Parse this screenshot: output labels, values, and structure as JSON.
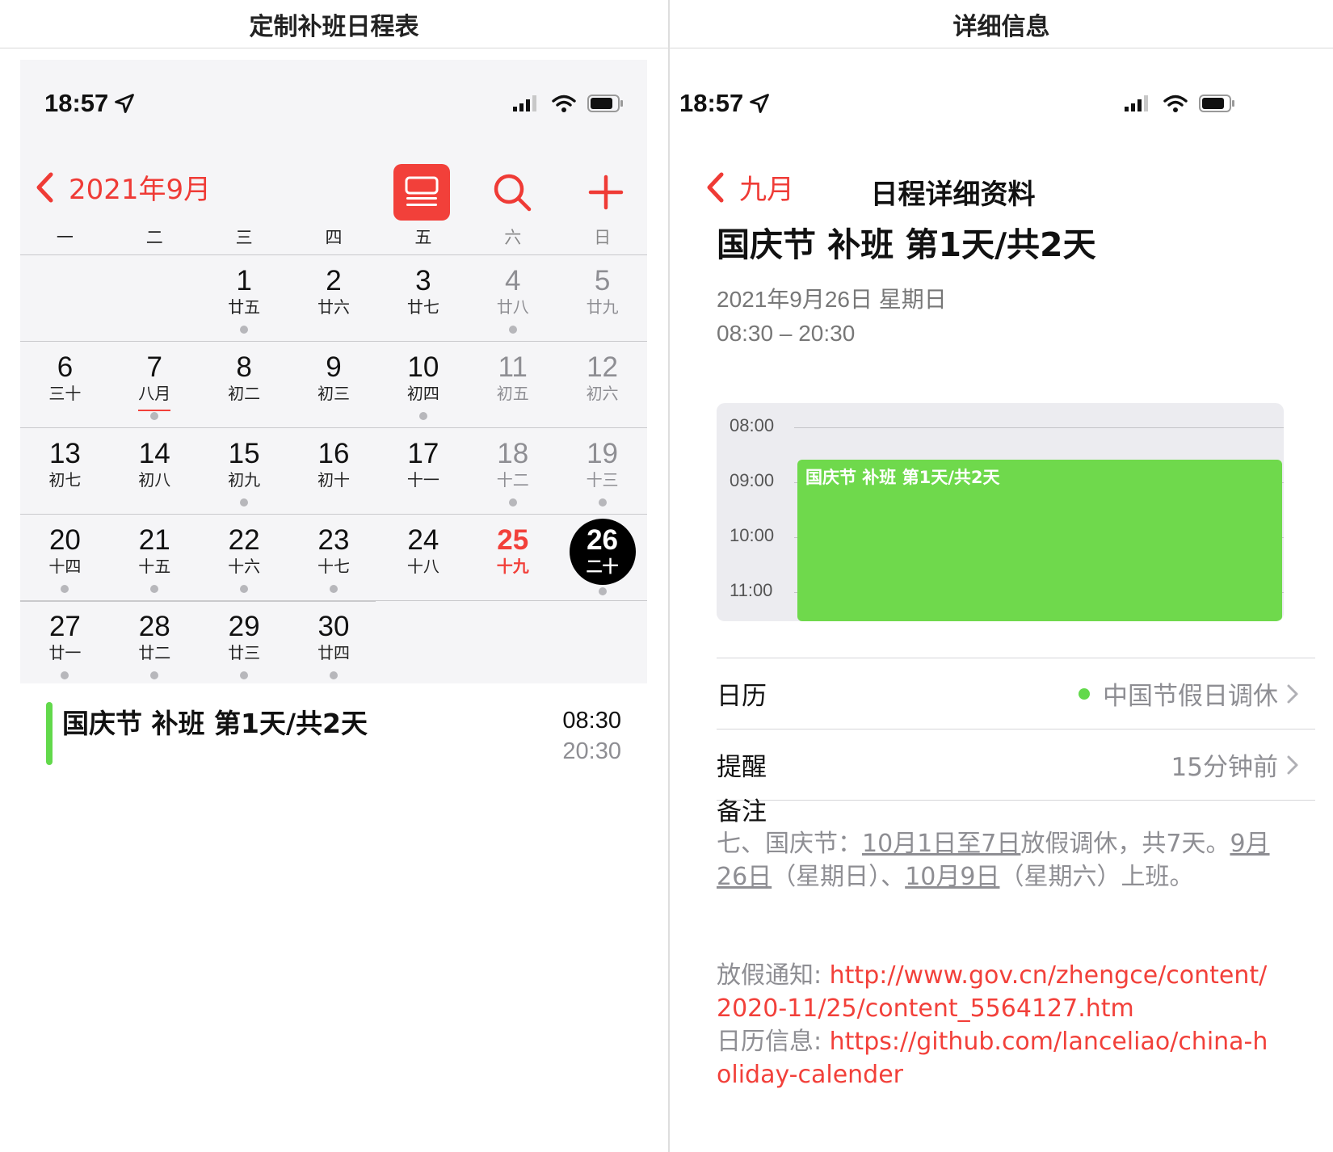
{
  "headers": {
    "left": "定制补班日程表",
    "right": "详细信息"
  },
  "status": {
    "time": "18:57"
  },
  "calendar": {
    "month_label": "2021年9月",
    "weekdays": [
      "一",
      "二",
      "三",
      "四",
      "五",
      "六",
      "日"
    ],
    "weeks": [
      [
        null,
        null,
        {
          "d": "1",
          "l": "廿五",
          "dot": true
        },
        {
          "d": "2",
          "l": "廿六"
        },
        {
          "d": "3",
          "l": "廿七"
        },
        {
          "d": "4",
          "l": "廿八",
          "dot": true
        },
        {
          "d": "5",
          "l": "廿九"
        }
      ],
      [
        {
          "d": "6",
          "l": "三十"
        },
        {
          "d": "7",
          "l": "八月",
          "dot": true,
          "underline": true
        },
        {
          "d": "8",
          "l": "初二"
        },
        {
          "d": "9",
          "l": "初三"
        },
        {
          "d": "10",
          "l": "初四",
          "dot": true
        },
        {
          "d": "11",
          "l": "初五"
        },
        {
          "d": "12",
          "l": "初六"
        }
      ],
      [
        {
          "d": "13",
          "l": "初七"
        },
        {
          "d": "14",
          "l": "初八"
        },
        {
          "d": "15",
          "l": "初九",
          "dot": true
        },
        {
          "d": "16",
          "l": "初十"
        },
        {
          "d": "17",
          "l": "十一"
        },
        {
          "d": "18",
          "l": "十二",
          "dot": true
        },
        {
          "d": "19",
          "l": "十三",
          "dot": true
        }
      ],
      [
        {
          "d": "20",
          "l": "十四",
          "dot": true
        },
        {
          "d": "21",
          "l": "十五",
          "dot": true
        },
        {
          "d": "22",
          "l": "十六",
          "dot": true
        },
        {
          "d": "23",
          "l": "十七",
          "dot": true
        },
        {
          "d": "24",
          "l": "十八"
        },
        {
          "d": "25",
          "l": "十九",
          "holiday": true
        },
        {
          "d": "26",
          "l": "二十",
          "today": true,
          "dot": true
        }
      ],
      [
        {
          "d": "27",
          "l": "廿一",
          "dot": true
        },
        {
          "d": "28",
          "l": "廿二",
          "dot": true
        },
        {
          "d": "29",
          "l": "廿三",
          "dot": true
        },
        {
          "d": "30",
          "l": "廿四",
          "dot": true
        },
        null,
        null,
        null
      ]
    ],
    "event": {
      "title": "国庆节 补班 第1天/共2天",
      "start": "08:30",
      "end": "20:30"
    }
  },
  "detail": {
    "back_label": "九月",
    "nav_title": "日程详细资料",
    "title": "国庆节 补班 第1天/共2天",
    "date": "2021年9月26日 星期日",
    "time_range": "08:30 – 20:30",
    "hours": [
      "08:00",
      "09:00",
      "10:00",
      "11:00"
    ],
    "mini_event_label": "国庆节 补班 第1天/共2天",
    "calendar_label": "日历",
    "calendar_value": "中国节假日调休",
    "alert_label": "提醒",
    "alert_value": "15分钟前",
    "notes_label": "备注",
    "notes": {
      "p1": "七、国庆节：",
      "u1": "10月1日至7日",
      "p2": "放假调休，共7天。",
      "u2": "9月26日",
      "p3": "（星期日）、",
      "u3": "10月9日",
      "p4": "（星期六）上班。"
    },
    "link1_label": "放假通知: ",
    "link1": "http://www.gov.cn/zhengce/content/2020-11/25/content_5564127.htm",
    "link2_label": "日历信息: ",
    "link2": "https://github.com/lanceliao/china-holiday-calender"
  },
  "colors": {
    "accent": "#f2403a",
    "event_green": "#6fd94c",
    "today": "#000000"
  }
}
